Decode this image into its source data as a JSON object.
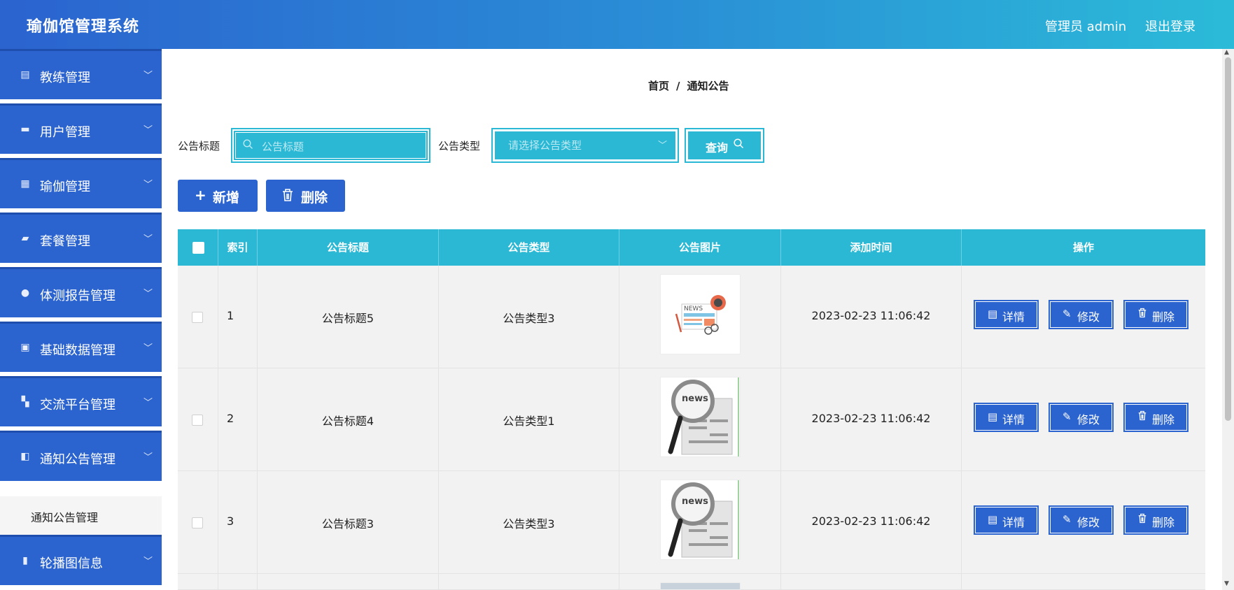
{
  "header": {
    "title": "瑜伽馆管理系统",
    "user_label": "管理员 admin",
    "logout_label": "退出登录"
  },
  "sidebar": {
    "items": [
      {
        "label": "教练管理",
        "icon": "chart-icon"
      },
      {
        "label": "用户管理",
        "icon": "monitor-icon"
      },
      {
        "label": "瑜伽管理",
        "icon": "grid-icon"
      },
      {
        "label": "套餐管理",
        "icon": "ticket-icon"
      },
      {
        "label": "体测报告管理",
        "icon": "user-icon"
      },
      {
        "label": "基础数据管理",
        "icon": "clipboard-icon"
      },
      {
        "label": "交流平台管理",
        "icon": "apps-icon"
      },
      {
        "label": "通知公告管理",
        "icon": "megaphone-icon"
      },
      {
        "label": "轮播图信息",
        "icon": "bar-chart-icon"
      }
    ],
    "active_sub": "通知公告管理"
  },
  "breadcrumb": {
    "home": "首页",
    "separator": "/",
    "current": "通知公告"
  },
  "search": {
    "title_label": "公告标题",
    "title_placeholder": "公告标题",
    "type_label": "公告类型",
    "type_placeholder": "请选择公告类型",
    "query_label": "查询"
  },
  "toolbar": {
    "add_label": "新增",
    "delete_label": "删除"
  },
  "table": {
    "columns": [
      "索引",
      "公告标题",
      "公告类型",
      "公告图片",
      "添加时间",
      "操作"
    ],
    "rows": [
      {
        "index": "1",
        "title": "公告标题5",
        "type": "公告类型3",
        "time": "2023-02-23 11:06:42",
        "image": "news-illustration"
      },
      {
        "index": "2",
        "title": "公告标题4",
        "type": "公告类型1",
        "time": "2023-02-23 11:06:42",
        "image": "magnifier-newspaper"
      },
      {
        "index": "3",
        "title": "公告标题3",
        "type": "公告类型3",
        "time": "2023-02-23 11:06:42",
        "image": "magnifier-newspaper"
      }
    ],
    "actions": {
      "detail": "详情",
      "edit": "修改",
      "delete": "删除"
    }
  },
  "colors": {
    "primary": "#2b63cf",
    "accent": "#2ab8d4",
    "header_gradient_end": "#2bbbd8"
  }
}
